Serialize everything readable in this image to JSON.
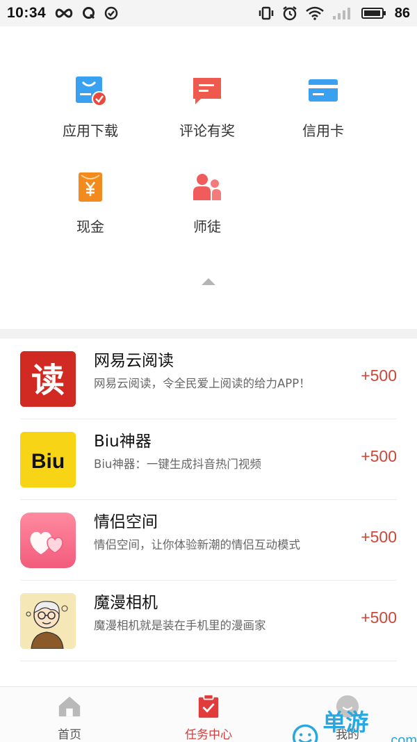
{
  "status_bar": {
    "time": "10:34",
    "battery": "86",
    "icons_left": [
      "infinity-icon",
      "q-icon",
      "check-circle-icon"
    ],
    "icons_right": [
      "vibrate-icon",
      "alarm-icon",
      "wifi-icon",
      "signal-icon",
      "battery-icon"
    ]
  },
  "categories": [
    {
      "label": "应用下载",
      "icon": "app-download-icon",
      "color": "#3aa0f0"
    },
    {
      "label": "评论有奖",
      "icon": "comment-icon",
      "color": "#ef5a4f"
    },
    {
      "label": "信用卡",
      "icon": "credit-card-icon",
      "color": "#3aa0f0"
    },
    {
      "label": "现金",
      "icon": "cash-icon",
      "color": "#f28a1e"
    },
    {
      "label": "师徒",
      "icon": "mentor-icon",
      "color": "#f05c5c"
    }
  ],
  "tasks": [
    {
      "title": "网易云阅读",
      "desc": "网易云阅读，令全民爱上阅读的给力APP！",
      "reward": "+500",
      "icon_text": "读"
    },
    {
      "title": "Biu神器",
      "desc": "Biu神器：一键生成抖音热门视频",
      "reward": "+500",
      "icon_text": "Biu"
    },
    {
      "title": "情侣空间",
      "desc": "情侣空间，让你体验新潮的情侣互动模式",
      "reward": "+500",
      "icon_text": ""
    },
    {
      "title": "魔漫相机",
      "desc": "魔漫相机就是装在手机里的漫画家",
      "reward": "+500",
      "icon_text": ""
    }
  ],
  "nav": [
    {
      "label": "首页",
      "icon": "home-icon"
    },
    {
      "label": "任务中心",
      "icon": "task-clipboard-icon",
      "active": true
    },
    {
      "label": "我的",
      "icon": "profile-icon"
    }
  ],
  "watermark": {
    "text": "单游网",
    "suffix": ".com"
  },
  "colors": {
    "accent": "#d93a3a",
    "reward": "#c9483b",
    "blue": "#3aa0f0"
  }
}
